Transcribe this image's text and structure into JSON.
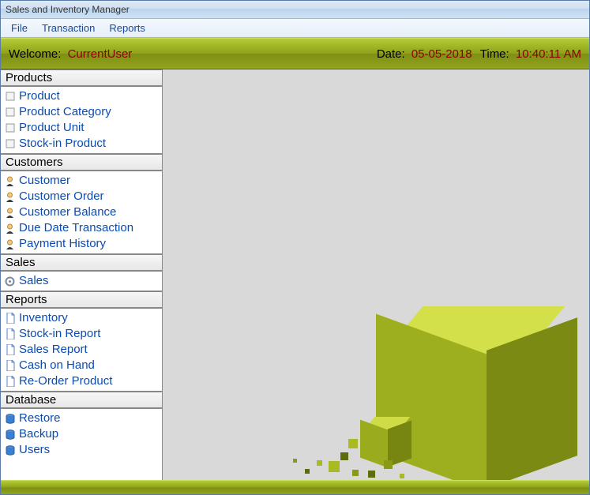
{
  "window": {
    "title": "Sales and Inventory Manager"
  },
  "menu": {
    "file": "File",
    "transaction": "Transaction",
    "reports": "Reports"
  },
  "welcome": {
    "welcome_label": "Welcome:",
    "user": "CurrentUser",
    "date_label": "Date:",
    "date": "05-05-2018",
    "time_label": "Time:",
    "time": "10:40:11 AM"
  },
  "sidebar": {
    "groups": [
      {
        "title": "Products",
        "items": [
          "Product",
          "Product Category",
          "Product Unit",
          "Stock-in Product"
        ]
      },
      {
        "title": "Customers",
        "items": [
          "Customer",
          "Customer Order",
          "Customer Balance",
          "Due Date Transaction",
          "Payment History"
        ]
      },
      {
        "title": "Sales",
        "items": [
          "Sales"
        ]
      },
      {
        "title": "Reports",
        "items": [
          "Inventory",
          "Stock-in Report",
          "Sales Report",
          "Cash on Hand",
          "Re-Order Product"
        ]
      },
      {
        "title": "Database",
        "items": [
          "Restore",
          "Backup",
          "Users"
        ]
      }
    ]
  }
}
